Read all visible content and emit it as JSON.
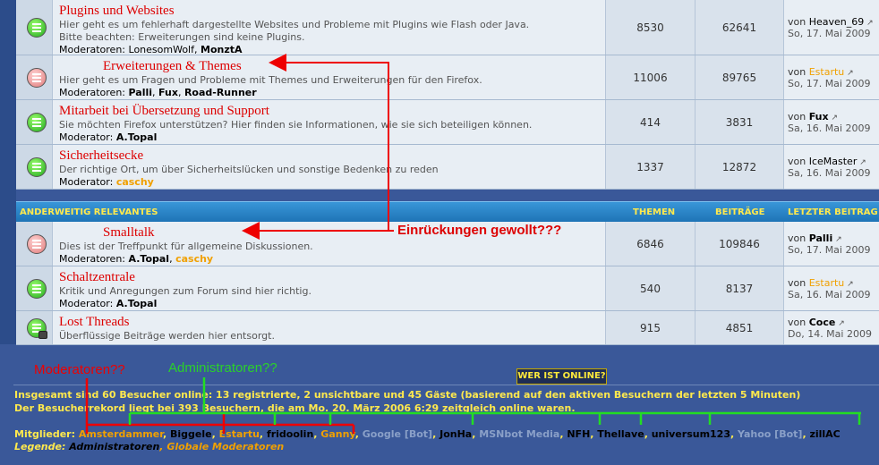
{
  "forums_top": [
    {
      "title": "Plugins und Websites",
      "desc": [
        "Hier geht es um fehlerhaft dargestellte Websites und Probleme mit Plugins wie Flash oder Java.",
        "Bitte beachten: Erweiterungen sind keine Plugins."
      ],
      "mods_label": "Moderatoren:",
      "mods": [
        {
          "name": "LonesomWolf",
          "style": "plain"
        },
        {
          "name": "MonztA",
          "style": "bold"
        }
      ],
      "topics": "8530",
      "posts": "62641",
      "last_by": "von",
      "last_user": "Heaven_69",
      "last_user_color": "plain",
      "last_date": "So, 17. Mai 2009",
      "icon": "green"
    },
    {
      "title": "Erweiterungen & Themes",
      "desc": [
        "Hier geht es um Fragen und Probleme mit Themes und Erweiterungen für den Firefox."
      ],
      "mods_label": "Moderatoren:",
      "mods": [
        {
          "name": "Palli",
          "style": "bold"
        },
        {
          "name": "Fux",
          "style": "bold"
        },
        {
          "name": "Road-Runner",
          "style": "bold"
        }
      ],
      "topics": "11006",
      "posts": "89765",
      "last_by": "von",
      "last_user": "Estartu",
      "last_user_color": "orange",
      "last_date": "So, 17. Mai 2009",
      "icon": "red"
    },
    {
      "title": "Mitarbeit bei Übersetzung und Support",
      "desc": [
        "Sie möchten Firefox unterstützen? Hier finden sie Informationen, wie sie sich beteiligen können."
      ],
      "mods_label": "Moderator:",
      "mods": [
        {
          "name": "A.Topal",
          "style": "bold"
        }
      ],
      "topics": "414",
      "posts": "3831",
      "last_by": "von",
      "last_user": "Fux",
      "last_user_color": "bold",
      "last_date": "Sa, 16. Mai 2009",
      "icon": "green"
    },
    {
      "title": "Sicherheitsecke",
      "desc": [
        "Der richtige Ort, um über Sicherheitslücken und sonstige Bedenken zu reden"
      ],
      "mods_label": "Moderator:",
      "mods": [
        {
          "name": "caschy",
          "style": "orange"
        }
      ],
      "topics": "1337",
      "posts": "12872",
      "last_by": "von",
      "last_user": "IceMaster",
      "last_user_color": "plain",
      "last_date": "Sa, 16. Mai 2009",
      "icon": "green"
    }
  ],
  "category": {
    "name": "ANDERWEITIG RELEVANTES",
    "col_topics": "THEMEN",
    "col_posts": "BEITRÄGE",
    "col_last": "LETZTER BEITRAG"
  },
  "forums_bottom": [
    {
      "title": "Smalltalk",
      "desc": [
        "Dies ist der Treffpunkt für allgemeine Diskussionen."
      ],
      "mods_label": "Moderatoren:",
      "mods": [
        {
          "name": "A.Topal",
          "style": "bold"
        },
        {
          "name": "caschy",
          "style": "orange"
        }
      ],
      "topics": "6846",
      "posts": "109846",
      "last_by": "von",
      "last_user": "Palli",
      "last_user_color": "bold",
      "last_date": "So, 17. Mai 2009",
      "icon": "red"
    },
    {
      "title": "Schaltzentrale",
      "desc": [
        "Kritik und Anregungen zum Forum sind hier richtig."
      ],
      "mods_label": "Moderator:",
      "mods": [
        {
          "name": "A.Topal",
          "style": "bold"
        }
      ],
      "topics": "540",
      "posts": "8137",
      "last_by": "von",
      "last_user": "Estartu",
      "last_user_color": "orange",
      "last_date": "Sa, 16. Mai 2009",
      "icon": "green"
    },
    {
      "title": "Lost Threads",
      "desc": [
        "Überflüssige Beiträge werden hier entsorgt."
      ],
      "mods_label": "",
      "mods": [],
      "topics": "915",
      "posts": "4851",
      "last_by": "von",
      "last_user": "Coce",
      "last_user_color": "bold",
      "last_date": "Do, 14. Mai 2009",
      "icon": "green-lock"
    }
  ],
  "who_is_online": {
    "button": "WER IST ONLINE?",
    "line1": "Insgesamt sind 60 Besucher online: 13 registrierte, 2 unsichtbare und 45 Gäste (basierend auf den aktiven Besuchern der letzten 5 Minuten)",
    "line2": "Der Besucherrekord liegt bei 393 Besuchern, die am Mo. 20. März 2006 6:29 zeitgleich online waren.",
    "members_label": "Mitglieder:",
    "members": [
      {
        "name": "Amsterdammer",
        "type": "n"
      },
      {
        "name": "Biggele",
        "type": "k"
      },
      {
        "name": "Estartu",
        "type": "n"
      },
      {
        "name": "fridoolin",
        "type": "k"
      },
      {
        "name": "Ganny",
        "type": "n"
      },
      {
        "name": "Google [Bot]",
        "type": "g"
      },
      {
        "name": "JonHa",
        "type": "k"
      },
      {
        "name": "MSNbot Media",
        "type": "g"
      },
      {
        "name": "NFH",
        "type": "k"
      },
      {
        "name": "Thellave",
        "type": "k"
      },
      {
        "name": "universum123",
        "type": "k"
      },
      {
        "name": "Yahoo [Bot]",
        "type": "g"
      },
      {
        "name": "zillAC",
        "type": "k"
      }
    ],
    "legend_label": "Legende:",
    "legend_admin": "Administratoren",
    "legend_gmod": "Globale Moderatoren"
  },
  "annotations": {
    "indent": "Einrückungen gewollt???",
    "mods": "Moderatoren??",
    "admins": "Administratoren??",
    "colors": {
      "red": "#ee0000",
      "green": "#22dd22"
    }
  },
  "colors": {
    "background": "#3a5899",
    "category_bar": "#1e74b6",
    "accent_yellow": "#ffe94d",
    "moderator_orange": "#f0a000",
    "title_red": "#dd0000"
  }
}
